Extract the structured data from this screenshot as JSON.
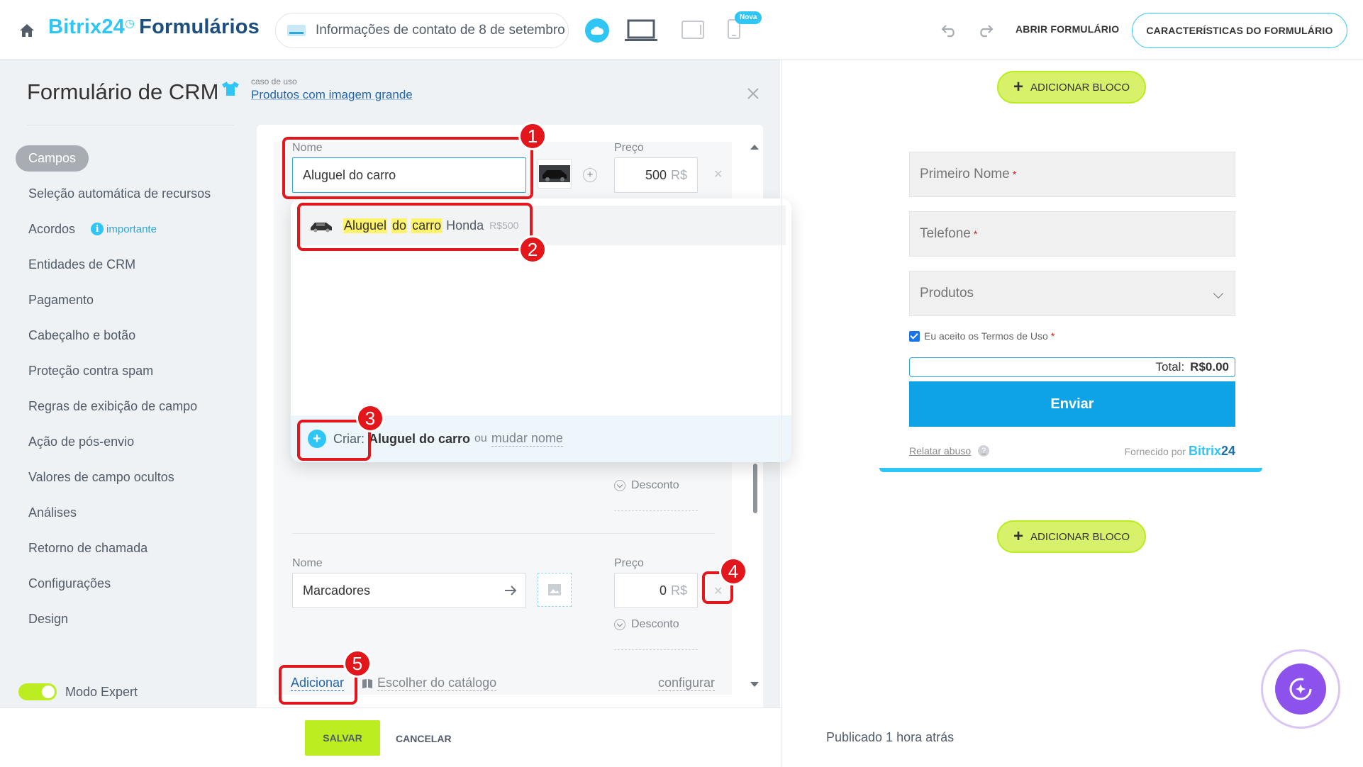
{
  "topbar": {
    "logo_brand": "Bitrix24",
    "logo_product": "Formulários",
    "form_selector_value": "Informações de contato de 8 de setembro",
    "new_badge": "Nova",
    "open_form": "ABRIR FORMULÁRIO",
    "form_features": "CARACTERÍSTICAS DO FORMULÁRIO"
  },
  "panel": {
    "title": "Formulário de CRM",
    "usecase_caption": "caso de uso",
    "usecase_link": "Produtos com imagem grande"
  },
  "sidebar": {
    "items": [
      {
        "label": "Campos",
        "active": true
      },
      {
        "label": "Seleção automática de recursos"
      },
      {
        "label": "Acordos",
        "badge": "importante"
      },
      {
        "label": "Entidades de CRM"
      },
      {
        "label": "Pagamento"
      },
      {
        "label": "Cabeçalho e botão"
      },
      {
        "label": "Proteção contra spam"
      },
      {
        "label": "Regras de exibição de campo"
      },
      {
        "label": "Ação de pós-envio"
      },
      {
        "label": "Valores de campo ocultos"
      },
      {
        "label": "Análises"
      },
      {
        "label": "Retorno de chamada"
      },
      {
        "label": "Configurações"
      },
      {
        "label": "Design"
      }
    ],
    "expert_mode": "Modo Expert"
  },
  "editor": {
    "product1": {
      "name_label": "Nome",
      "name_value": "Aluguel do carro",
      "price_label": "Preço",
      "price_value": "500",
      "currency": "R$"
    },
    "dropdown": {
      "option_hl1": "Aluguel",
      "option_hl2": "do",
      "option_hl3": "carro",
      "option_rest": "Honda",
      "option_price": "R$500",
      "create_label": "Criar:",
      "create_value": "Aluguel do carro",
      "or_text": "ou",
      "rename_text": "mudar nome"
    },
    "hidden_discount": "Desconto",
    "product2": {
      "name_label": "Nome",
      "name_value": "Marcadores",
      "price_label": "Preço",
      "price_value": "0",
      "currency": "R$",
      "discount": "Desconto"
    },
    "add_link": "Adicionar",
    "catalog_link": "Escolher do catálogo",
    "configure_link": "configurar"
  },
  "annotations": [
    "1",
    "2",
    "3",
    "4",
    "5"
  ],
  "bottom": {
    "save": "SALVAR",
    "cancel": "CANCELAR"
  },
  "preview": {
    "add_block": "ADICIONAR BLOCO",
    "first_name": "Primeiro Nome",
    "phone": "Telefone",
    "products": "Produtos",
    "terms": "Eu aceito os Termos de Uso",
    "total_label": "Total:",
    "total_value": "R$0.00",
    "submit": "Enviar",
    "report_abuse": "Relatar abuso",
    "powered_by": "Fornecido por",
    "powered_brand": "Bitrix",
    "powered_num": "24",
    "published": "Publicado 1 hora atrás"
  },
  "colors": {
    "accent": "#2fc6f6",
    "green": "#bbed21",
    "annotation_red": "#e2161b",
    "submit_blue": "#0ea2e6"
  }
}
